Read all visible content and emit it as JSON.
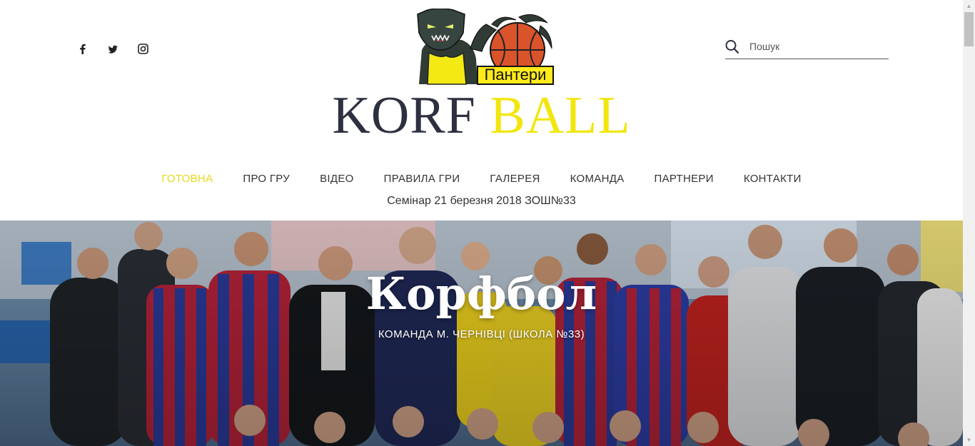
{
  "social": {
    "items": [
      {
        "name": "facebook-icon",
        "glyph": "f"
      },
      {
        "name": "twitter-icon"
      },
      {
        "name": "instagram-icon"
      }
    ]
  },
  "search": {
    "placeholder": "Пошук"
  },
  "logo": {
    "badge_text": "Пантери"
  },
  "brand": {
    "word1": "KORF",
    "word2": "BALL"
  },
  "nav": {
    "items": [
      {
        "label": "ГОТОВНА",
        "active": true
      },
      {
        "label": "ПРО ГРУ"
      },
      {
        "label": "ВІДЕО"
      },
      {
        "label": "ПРАВИЛА ГРИ"
      },
      {
        "label": "ГАЛЕРЕЯ"
      },
      {
        "label": "КОМАНДА"
      },
      {
        "label": "ПАРТНЕРИ"
      },
      {
        "label": "КОНТАКТИ"
      }
    ]
  },
  "news_line": "Семінар 21 березня 2018 ЗОШ№33",
  "hero": {
    "title": "Корфбол",
    "subtitle": "КОМАНДА М. ЧЕРНІВЦІ (ШКОЛА №33)"
  },
  "colors": {
    "accent": "#f2e60d",
    "nav_active": "#e8d917",
    "brand_dark": "#2d3040"
  }
}
